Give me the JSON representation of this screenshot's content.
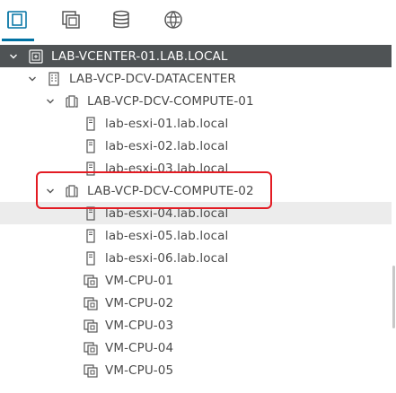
{
  "toolbar": {
    "tabs": [
      {
        "icon": "hosts-and-clusters-icon",
        "active": true
      },
      {
        "icon": "vms-and-templates-icon",
        "active": false
      },
      {
        "icon": "storage-icon",
        "active": false
      },
      {
        "icon": "networking-icon",
        "active": false
      }
    ]
  },
  "tree": {
    "vcenter": "LAB-VCENTER-01.LAB.LOCAL",
    "datacenter": "LAB-VCP-DCV-DATACENTER",
    "cluster1": "LAB-VCP-DCV-COMPUTE-01",
    "host1": "lab-esxi-01.lab.local",
    "host2": "lab-esxi-02.lab.local",
    "host3": "lab-esxi-03.lab.local",
    "cluster2": "LAB-VCP-DCV-COMPUTE-02",
    "host4": "lab-esxi-04.lab.local",
    "host5": "lab-esxi-05.lab.local",
    "host6": "lab-esxi-06.lab.local",
    "vm1": "VM-CPU-01",
    "vm2": "VM-CPU-02",
    "vm3": "VM-CPU-03",
    "vm4": "VM-CPU-04",
    "vm5": "VM-CPU-05"
  },
  "colors": {
    "selected_row": "#4f5355",
    "highlight_box": "#e31b23",
    "active_tab": "#0072a3"
  }
}
